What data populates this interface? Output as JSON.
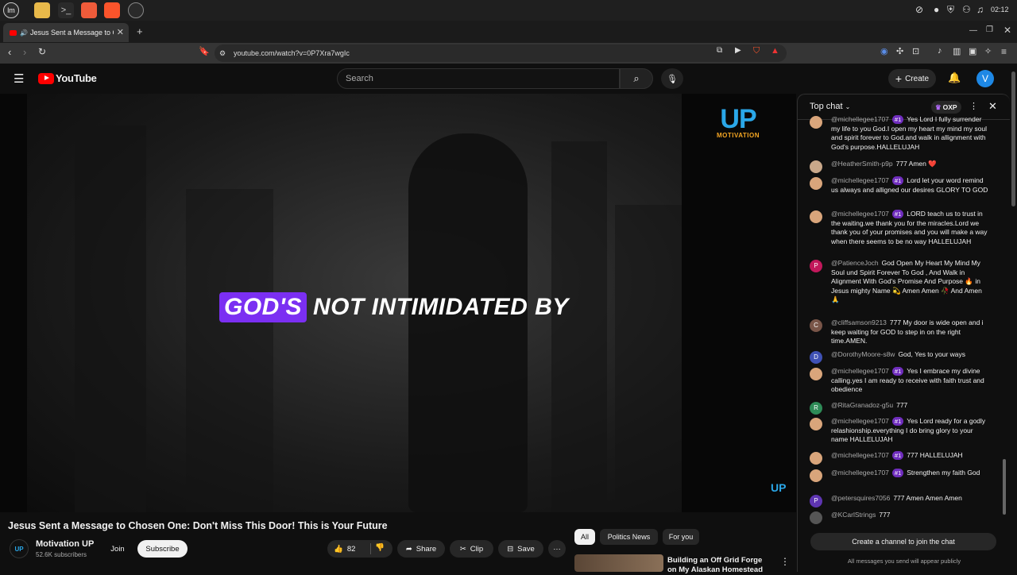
{
  "os": {
    "clock": "02:12"
  },
  "tab": {
    "title": "Jesus Sent a Message to C",
    "new_tab": "+"
  },
  "address": {
    "url": "youtube.com/watch?v=0P7Xra7wgIc"
  },
  "youtube": {
    "logo_text": "YouTube",
    "search_placeholder": "Search",
    "create_label": "Create",
    "avatar_letter": "V"
  },
  "video": {
    "caption_highlight": "GOD'S",
    "caption_rest": "NOT INTIMIDATED BY",
    "watermark_top": "UP",
    "watermark_sub": "MOTIVATION",
    "watermark_corner": "UP"
  },
  "details": {
    "title": "Jesus Sent a Message to Chosen One: Don't Miss This Door! This is Your Future",
    "channel": "Motivation UP",
    "channel_avatar": "UP",
    "subscribers": "52.6K subscribers",
    "join": "Join",
    "subscribe": "Subscribe",
    "likes": "82",
    "share": "Share",
    "clip": "Clip",
    "save": "Save",
    "more": "···"
  },
  "recs": {
    "chips": [
      "All",
      "Politics News",
      "For you"
    ],
    "first_title": "Building an Off Grid Forge on My Alaskan Homestead"
  },
  "chat": {
    "header": "Top chat",
    "oxp": "OXP",
    "messages": [
      {
        "author": "@michellegee1707",
        "badge": "#1",
        "text": "Yes Lord I fully surrender my life to you God.I open my heart my mind my soul and spirit forever to God.and walk in allignment with God's purpose.HALLELUJAH",
        "avatar": "",
        "color": "#d9a57b"
      },
      {
        "author": "@HeatherSmith-p9p",
        "badge": "",
        "text": "777 Amen ❤️",
        "avatar": "",
        "color": "#c9a88a"
      },
      {
        "author": "@michellegee1707",
        "badge": "#1",
        "text": "Lord let your word remind us always and alligned our desires GLORY TO GOD",
        "avatar": "",
        "color": "#d9a57b"
      },
      {
        "author": "@michellegee1707",
        "badge": "#1",
        "text": "LORD teach us to trust in the waiting.we thank you for the miracles.Lord we thank you of your promises and you will make a way when there seems to be no way HALLELUJAH",
        "avatar": "",
        "color": "#d9a57b"
      },
      {
        "author": "@PatienceJoch",
        "badge": "",
        "text": "God Open My Heart My Mind My Soul und Spirit Forever To God , And Walk in Alignment With God's Promise And Purpose 🔥 in Jesus mighty Name 💫 Amen Amen 🥀 And Amen 🙏",
        "avatar": "P",
        "color": "#c2185b"
      },
      {
        "author": "@cliffsamson9213",
        "badge": "",
        "text": "777 My door is wide open and i keep waiting for GOD to step in on the right time.AMEN.",
        "avatar": "C",
        "color": "#795548"
      },
      {
        "author": "@DorothyMoore-s8w",
        "badge": "",
        "text": "God, Yes to your ways",
        "avatar": "D",
        "color": "#3f51b5"
      },
      {
        "author": "@michellegee1707",
        "badge": "#1",
        "text": "Yes I embrace my divine calling.yes I am ready to receive with faith trust and obedience",
        "avatar": "",
        "color": "#d9a57b"
      },
      {
        "author": "@RitaGranadoz-g5u",
        "badge": "",
        "text": "777",
        "avatar": "R",
        "color": "#2e8b57"
      },
      {
        "author": "@michellegee1707",
        "badge": "#1",
        "text": "Yes Lord ready for a godly relashionship.everything I do bring glory to your name HALLELUJAH",
        "avatar": "",
        "color": "#d9a57b"
      },
      {
        "author": "@michellegee1707",
        "badge": "#1",
        "text": "777 HALLELUJAH",
        "avatar": "",
        "color": "#d9a57b"
      },
      {
        "author": "@michellegee1707",
        "badge": "#1",
        "text": "Strengthen my faith God",
        "avatar": "",
        "color": "#d9a57b"
      },
      {
        "author": "@petersquires7056",
        "badge": "",
        "text": "777 Amen Amen Amen",
        "avatar": "P",
        "color": "#5e35b1"
      },
      {
        "author": "@KCarlStrings",
        "badge": "",
        "text": "777",
        "avatar": "",
        "color": "#555555"
      }
    ],
    "join_prompt": "Create a channel to join the chat",
    "public_note": "All messages you send will appear publicly"
  }
}
